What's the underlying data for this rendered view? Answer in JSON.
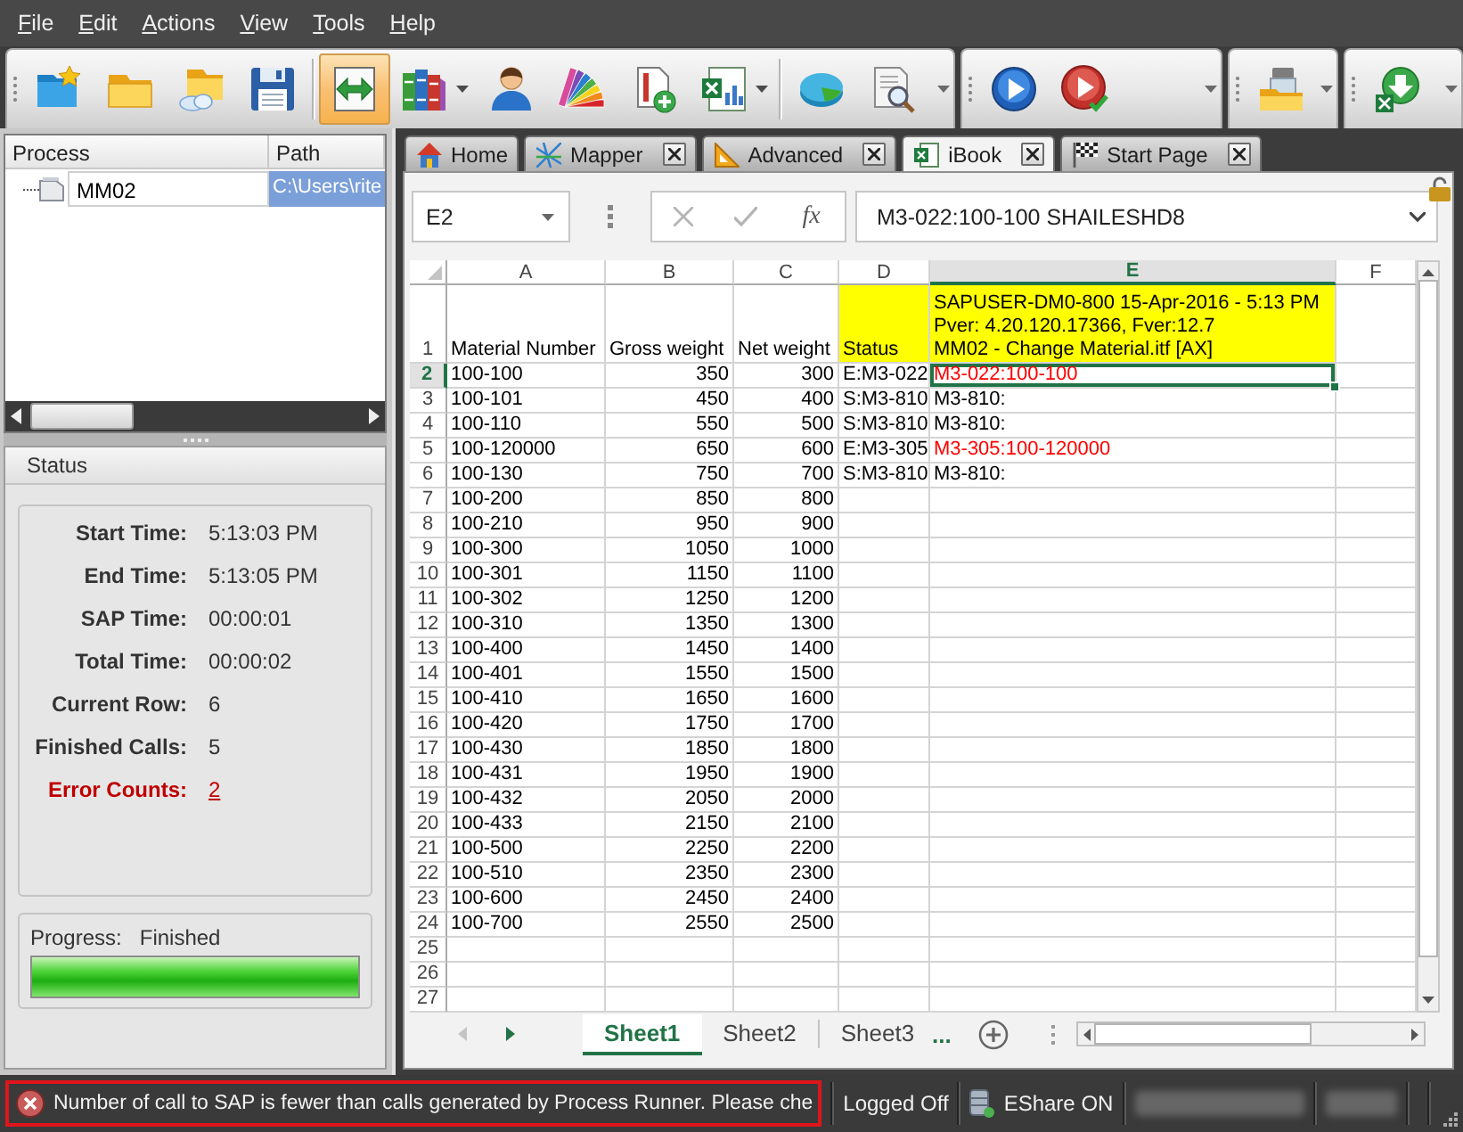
{
  "menu": [
    "File",
    "Edit",
    "Actions",
    "View",
    "Tools",
    "Help"
  ],
  "toolbar": [
    {
      "sections": [
        {
          "buttons": [
            {
              "selected": false,
              "dropdown": false
            },
            {
              "selected": false,
              "dropdown": false
            },
            {
              "selected": false,
              "dropdown": false
            },
            {
              "selected": false,
              "dropdown": false
            }
          ]
        },
        {
          "buttons": [
            {
              "selected": true,
              "dropdown": false
            },
            {
              "selected": false,
              "dropdown": true
            },
            {
              "selected": false,
              "dropdown": false
            },
            {
              "selected": false,
              "dropdown": false
            },
            {
              "selected": false,
              "dropdown": false
            },
            {
              "selected": false,
              "dropdown": true
            }
          ]
        },
        {
          "buttons": [
            {
              "selected": false,
              "dropdown": false
            },
            {
              "selected": false,
              "dropdown": false
            }
          ]
        }
      ]
    },
    {
      "sections": [
        {
          "buttons": [
            {
              "selected": false,
              "dropdown": false
            },
            {
              "selected": false,
              "dropdown": false
            }
          ]
        }
      ]
    },
    {
      "sections": [
        {
          "buttons": [
            {
              "selected": false,
              "dropdown": false
            }
          ]
        }
      ]
    },
    {
      "sections": [
        {
          "buttons": [
            {
              "selected": false,
              "dropdown": false
            }
          ]
        }
      ]
    }
  ],
  "process_tree": {
    "columns": [
      "Process",
      "Path"
    ],
    "rows": [
      {
        "process": "MM02",
        "path": "C:\\Users\\rite",
        "selected": true
      }
    ]
  },
  "status_panel": {
    "title": "Status",
    "fields": [
      {
        "label": "Start Time:",
        "value": "5:13:03 PM",
        "kind": "plain"
      },
      {
        "label": "End Time:",
        "value": "5:13:05 PM",
        "kind": "plain"
      },
      {
        "label": "SAP Time:",
        "value": "00:00:01",
        "kind": "plain"
      },
      {
        "label": "Total Time:",
        "value": "00:00:02",
        "kind": "plain"
      },
      {
        "label": "Current Row:",
        "value": "6",
        "kind": "plain"
      },
      {
        "label": "Finished Calls:",
        "value": "5",
        "kind": "plain"
      },
      {
        "label": "Error Counts:",
        "value": "2",
        "kind": "error"
      }
    ],
    "progress": {
      "label": "Progress:",
      "value": "Finished",
      "level": 1
    }
  },
  "tabs": [
    {
      "label": "Home",
      "selected": false,
      "closable": false
    },
    {
      "label": "Mapper",
      "selected": false,
      "closable": true
    },
    {
      "label": "Advanced",
      "selected": false,
      "closable": true
    },
    {
      "label": "iBook",
      "selected": true,
      "closable": true
    },
    {
      "label": "Start Page",
      "selected": false,
      "closable": true
    }
  ],
  "sheet": {
    "name_box": "E2",
    "function_label": "fx",
    "formula": "M3-022:100-100 SHAILESHD8",
    "columns": [
      {
        "label": "A",
        "selected": false
      },
      {
        "label": "B",
        "selected": false
      },
      {
        "label": "C",
        "selected": false
      },
      {
        "label": "D",
        "selected": false
      },
      {
        "label": "E",
        "selected": true
      },
      {
        "label": "F",
        "selected": false
      }
    ],
    "title_row": {
      "number": "1",
      "selected": false,
      "cells": [
        {
          "text": "Material Number",
          "highlight": false
        },
        {
          "text": "Gross weight",
          "highlight": false
        },
        {
          "text": "Net weight",
          "highlight": false
        },
        {
          "text": "Status",
          "highlight": true
        },
        {
          "text": "SAPUSER-DM0-800 15-Apr-2016 - 5:13 PM\nPver: 4.20.120.17366, Fver:12.7\nMM02 - Change Material.itf [AX]",
          "highlight": true
        }
      ]
    },
    "rows": [
      {
        "number": "2",
        "selected": true,
        "error": true,
        "cells": [
          "100-100",
          "350",
          "300",
          "E:M3-022",
          "M3-022:100-100"
        ]
      },
      {
        "number": "3",
        "selected": false,
        "error": false,
        "cells": [
          "100-101",
          "450",
          "400",
          "S:M3-810",
          "M3-810:"
        ]
      },
      {
        "number": "4",
        "selected": false,
        "error": false,
        "cells": [
          "100-110",
          "550",
          "500",
          "S:M3-810",
          "M3-810:"
        ]
      },
      {
        "number": "5",
        "selected": false,
        "error": true,
        "cells": [
          "100-120000",
          "650",
          "600",
          "E:M3-305",
          "M3-305:100-120000"
        ]
      },
      {
        "number": "6",
        "selected": false,
        "error": false,
        "cells": [
          "100-130",
          "750",
          "700",
          "S:M3-810",
          "M3-810:"
        ]
      },
      {
        "number": "7",
        "selected": false,
        "cells": [
          "100-200",
          "850",
          "800"
        ]
      },
      {
        "number": "8",
        "selected": false,
        "cells": [
          "100-210",
          "950",
          "900"
        ]
      },
      {
        "number": "9",
        "selected": false,
        "cells": [
          "100-300",
          "1050",
          "1000"
        ]
      },
      {
        "number": "10",
        "selected": false,
        "cells": [
          "100-301",
          "1150",
          "1100"
        ]
      },
      {
        "number": "11",
        "selected": false,
        "cells": [
          "100-302",
          "1250",
          "1200"
        ]
      },
      {
        "number": "12",
        "selected": false,
        "cells": [
          "100-310",
          "1350",
          "1300"
        ]
      },
      {
        "number": "13",
        "selected": false,
        "cells": [
          "100-400",
          "1450",
          "1400"
        ]
      },
      {
        "number": "14",
        "selected": false,
        "cells": [
          "100-401",
          "1550",
          "1500"
        ]
      },
      {
        "number": "15",
        "selected": false,
        "cells": [
          "100-410",
          "1650",
          "1600"
        ]
      },
      {
        "number": "16",
        "selected": false,
        "cells": [
          "100-420",
          "1750",
          "1700"
        ]
      },
      {
        "number": "17",
        "selected": false,
        "cells": [
          "100-430",
          "1850",
          "1800"
        ]
      },
      {
        "number": "18",
        "selected": false,
        "cells": [
          "100-431",
          "1950",
          "1900"
        ]
      },
      {
        "number": "19",
        "selected": false,
        "cells": [
          "100-432",
          "2050",
          "2000"
        ]
      },
      {
        "number": "20",
        "selected": false,
        "cells": [
          "100-433",
          "2150",
          "2100"
        ]
      },
      {
        "number": "21",
        "selected": false,
        "cells": [
          "100-500",
          "2250",
          "2200"
        ]
      },
      {
        "number": "22",
        "selected": false,
        "cells": [
          "100-510",
          "2350",
          "2300"
        ]
      },
      {
        "number": "23",
        "selected": false,
        "cells": [
          "100-600",
          "2450",
          "2400"
        ]
      },
      {
        "number": "24",
        "selected": false,
        "cells": [
          "100-700",
          "2550",
          "2500"
        ]
      },
      {
        "number": "25",
        "selected": false,
        "cells": []
      },
      {
        "number": "26",
        "selected": false,
        "cells": []
      },
      {
        "number": "27",
        "selected": false,
        "cells": []
      }
    ],
    "sheet_tabs": [
      {
        "label": "Sheet1",
        "selected": true
      },
      {
        "label": "Sheet2",
        "selected": false
      },
      {
        "label": "Sheet3",
        "selected": false
      }
    ],
    "more_tabs": "..."
  },
  "status_bar": {
    "message": "Number of call to SAP is fewer than calls generated by Process Runner. Please che",
    "items": [
      {
        "text": "Logged Off",
        "kind": "text"
      },
      {
        "text": "EShare ON",
        "kind": "share"
      }
    ]
  }
}
